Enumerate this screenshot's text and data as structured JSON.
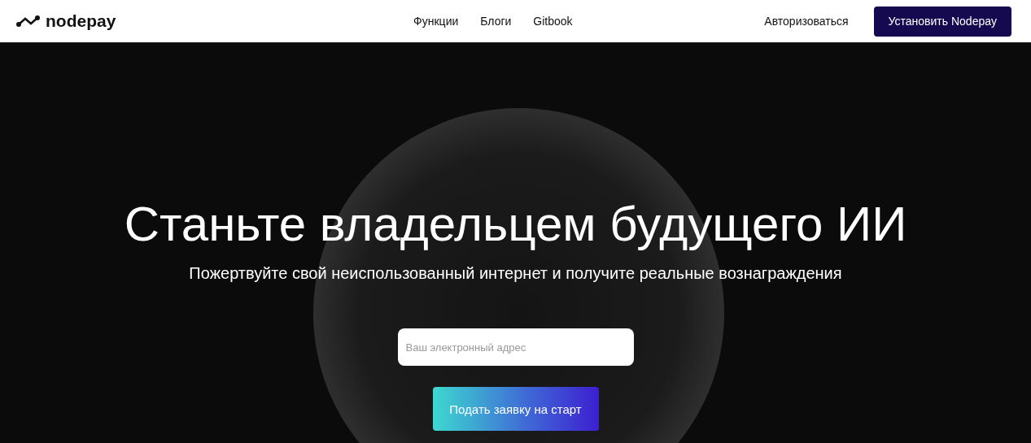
{
  "header": {
    "logo": "nodepay",
    "nav": [
      "Функции",
      "Блоги",
      "Gitbook"
    ],
    "login": "Авторизоваться",
    "install_button": "Установить Nodepay"
  },
  "hero": {
    "title": "Станьте владельцем будущего ИИ",
    "subtitle": "Пожертвуйте свой неиспользованный интернет и получите реальные вознаграждения",
    "email_field": {
      "placeholder": "Ваш электронный адрес"
    },
    "submit_button": "Подать заявку на старт"
  }
}
